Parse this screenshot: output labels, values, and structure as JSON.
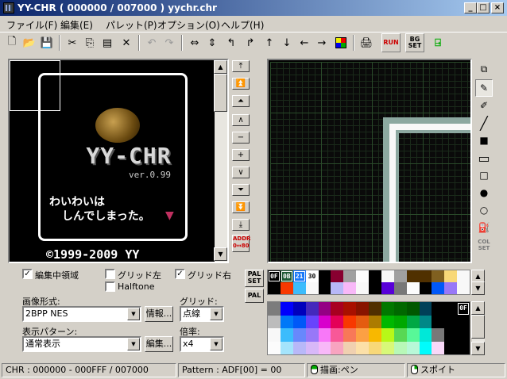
{
  "window": {
    "title": "YY-CHR ( 000000 / 007000 ) yychr.chr",
    "minimize": "_",
    "maximize": "□",
    "close": "×"
  },
  "menu": [
    "ファイル(F)",
    "編集(E)",
    "パレット(P)",
    "オプション(O)",
    "ヘルプ(H)"
  ],
  "toolbar": {
    "run_label": "RUN",
    "bgset_label": "BG SET"
  },
  "preview": {
    "title_text": "YY-CHR",
    "version_text": "ver.0.99",
    "line1": "わいわいは",
    "line2": "しんでしまった。",
    "copyright": "©1999-2009 YY"
  },
  "nav": {
    "addr_label": "ADDR 0↔80"
  },
  "tools": {
    "colset_label": "COL SET"
  },
  "options": {
    "edit_area": {
      "label": "編集中領域",
      "checked": true
    },
    "grid_left": {
      "label": "グリッド左",
      "checked": false
    },
    "grid_right": {
      "label": "グリッド右",
      "checked": true
    },
    "halftone": {
      "label": "Halftone",
      "checked": false
    },
    "image_format_label": "画像形式:",
    "image_format_value": "2BPP NES",
    "info_button": "情報...",
    "grid_label": "グリッド:",
    "grid_value": "点線",
    "display_pattern_label": "表示パターン:",
    "display_pattern_value": "通常表示",
    "edit_button": "編集...",
    "zoom_label": "倍率:",
    "zoom_value": "x4"
  },
  "palette": {
    "palset_label": "PAL SET",
    "pal_label": "PAL",
    "selected_labels": [
      "0F",
      "0B",
      "21",
      "30"
    ],
    "row1": [
      "#000000",
      "#1e5a34",
      "#1878f8",
      "#fcfcfc",
      "#000000",
      "#880030",
      "#a0a0a0",
      "#fcfcfc",
      "#000000",
      "#f8f8f8",
      "#a0a0a0",
      "#503000",
      "#503000",
      "#806020",
      "#f8d878",
      "#f8f8f8"
    ],
    "row2": [
      "#000000",
      "#f83800",
      "#3cbcfc",
      "#f8f8f8",
      "#000000",
      "#b8b8f8",
      "#f8b8f8",
      "#f8f8f8",
      "#000000",
      "#5800d8",
      "#787878",
      "#fcfcfc",
      "#000000",
      "#0058f8",
      "#9878f8",
      "#f8f8f8"
    ]
  },
  "full_palette": {
    "rows": [
      [
        "#7c7c7c",
        "#0000fc",
        "#0000bc",
        "#4428bc",
        "#940084",
        "#a80020",
        "#a81000",
        "#881400",
        "#503000",
        "#007800",
        "#006800",
        "#005800",
        "#004058",
        "#000000",
        "#000000",
        "#000000"
      ],
      [
        "#bcbcbc",
        "#0078f8",
        "#0058f8",
        "#6844fc",
        "#d800cc",
        "#e40058",
        "#f83800",
        "#e45c10",
        "#ac7c00",
        "#00b800",
        "#00a800",
        "#00a844",
        "#008888",
        "#000000",
        "#000000",
        "#000000"
      ],
      [
        "#f8f8f8",
        "#3cbcfc",
        "#6888fc",
        "#9878f8",
        "#f878f8",
        "#f85898",
        "#f87858",
        "#fca044",
        "#f8b800",
        "#b8f818",
        "#58d854",
        "#58f898",
        "#00e8d8",
        "#787878",
        "#000000",
        "#000000"
      ],
      [
        "#fcfcfc",
        "#a4e4fc",
        "#b8b8f8",
        "#d8b8f8",
        "#f8b8f8",
        "#f8a4c0",
        "#f0d0b0",
        "#fce0a8",
        "#f8d878",
        "#d8f878",
        "#b8f8b8",
        "#b8f8d8",
        "#00fcfc",
        "#f8d8f8",
        "#000000",
        "#000000"
      ]
    ],
    "marker": "0F"
  },
  "status": {
    "chr": "CHR : 000000 - 000FFF / 007000",
    "pattern": "Pattern : ADF[00] = 00",
    "left_click": "描画:ペン",
    "right_click": "スポイト"
  }
}
